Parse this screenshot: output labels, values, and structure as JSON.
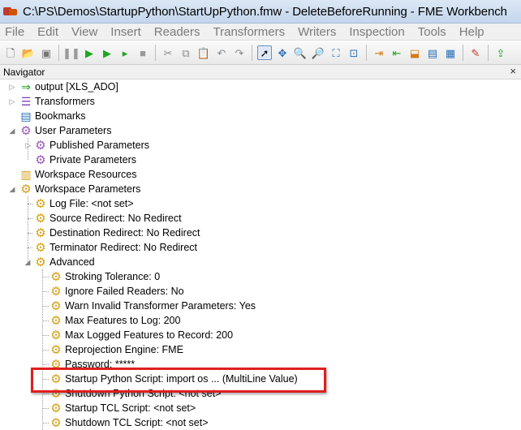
{
  "window": {
    "title": "C:\\PS\\Demos\\StartupPython\\StartUpPython.fmw - DeleteBeforeRunning - FME Workbench"
  },
  "menu": [
    "File",
    "Edit",
    "View",
    "Insert",
    "Readers",
    "Transformers",
    "Writers",
    "Inspection",
    "Tools",
    "Help"
  ],
  "toolbar": {
    "icons": [
      "new-icon",
      "open-icon",
      "save-icon",
      "pause-icon",
      "run-icon",
      "run-step-icon",
      "run-partial-icon",
      "stop-icon",
      "cut-icon",
      "copy-icon",
      "paste-icon",
      "undo-icon",
      "redo-icon",
      "select-icon",
      "pan-icon",
      "zoom-in-icon",
      "zoom-out-icon",
      "zoom-fit-icon",
      "zoom-selected-icon",
      "reader-icon",
      "writer-icon",
      "feature-type-icon",
      "bookmark-icon",
      "grid-icon",
      "options-icon",
      "publish-icon"
    ]
  },
  "navigator": {
    "title": "Navigator",
    "close": "×",
    "items": {
      "output": "output [XLS_ADO]",
      "transformers": "Transformers",
      "bookmarks": "Bookmarks",
      "user_parameters": "User Parameters",
      "published_parameters": "Published Parameters",
      "private_parameters": "Private Parameters",
      "workspace_resources": "Workspace Resources",
      "workspace_parameters": "Workspace Parameters",
      "log_file": "Log File: <not set>",
      "source_redirect": "Source Redirect: No Redirect",
      "destination_redirect": "Destination Redirect: No Redirect",
      "terminator_redirect": "Terminator Redirect: No Redirect",
      "advanced": "Advanced",
      "stroking_tolerance": "Stroking Tolerance: 0",
      "ignore_failed_readers": "Ignore Failed Readers: No",
      "warn_invalid": "Warn Invalid Transformer Parameters: Yes",
      "max_features_log": "Max Features to Log: 200",
      "max_logged_features": "Max Logged Features to Record: 200",
      "reprojection_engine": "Reprojection Engine: FME",
      "password": "Password: *****",
      "startup_python": "Startup Python Script: import os  ... (MultiLine Value)",
      "shutdown_python": "Shutdown Python Script: <not set>",
      "startup_tcl": "Startup TCL Script: <not set>",
      "shutdown_tcl": "Shutdown TCL Script: <not set>"
    }
  }
}
